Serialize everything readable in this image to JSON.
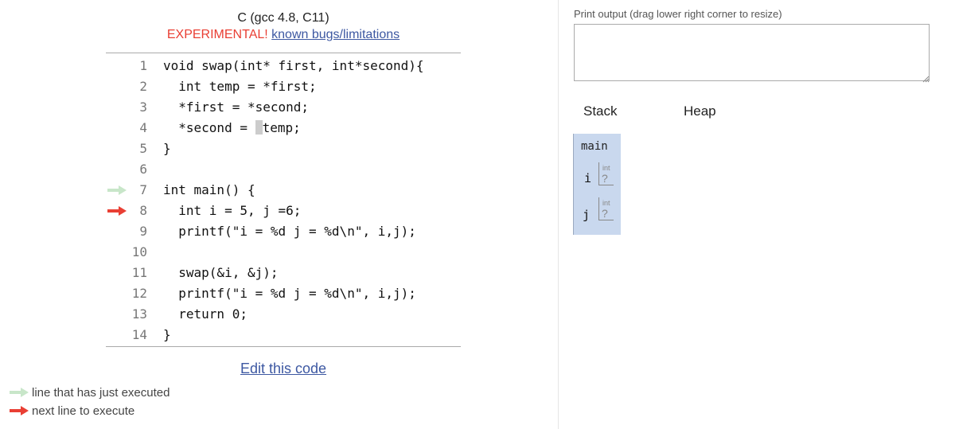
{
  "header": {
    "language": "C (gcc 4.8, C11)",
    "experimental": "EXPERIMENTAL!",
    "bugs_link": "known bugs/limitations"
  },
  "code": {
    "lines": [
      {
        "n": "1",
        "text": "void swap(int* first, int*second){"
      },
      {
        "n": "2",
        "text": "  int temp = *first;"
      },
      {
        "n": "3",
        "text": "  *first = *second;"
      },
      {
        "n": "4a",
        "text": "  *second = "
      },
      {
        "n": "4b",
        "text": "temp;"
      },
      {
        "n": "5",
        "text": "}"
      },
      {
        "n": "6",
        "text": ""
      },
      {
        "n": "7",
        "text": "int main() {"
      },
      {
        "n": "8",
        "text": "  int i = 5, j =6;"
      },
      {
        "n": "9",
        "text": "  printf(\"i = %d j = %d\\n\", i,j);"
      },
      {
        "n": "10",
        "text": ""
      },
      {
        "n": "11",
        "text": "  swap(&i, &j);"
      },
      {
        "n": "12",
        "text": "  printf(\"i = %d j = %d\\n\", i,j);"
      },
      {
        "n": "13",
        "text": "  return 0;"
      },
      {
        "n": "14",
        "text": "}"
      }
    ],
    "line_numbers": [
      "1",
      "2",
      "3",
      "4",
      "5",
      "6",
      "7",
      "8",
      "9",
      "10",
      "11",
      "12",
      "13",
      "14"
    ]
  },
  "edit_link": "Edit this code",
  "legend": {
    "executed": "line that has just executed",
    "next": "next line to execute"
  },
  "output": {
    "label": "Print output (drag lower right corner to resize)",
    "value": ""
  },
  "viz": {
    "stack_label": "Stack",
    "heap_label": "Heap",
    "frame_name": "main",
    "vars": [
      {
        "name": "i",
        "type": "int",
        "value": "?"
      },
      {
        "name": "j",
        "type": "int",
        "value": "?"
      }
    ]
  },
  "colors": {
    "executed_arrow": "#c8e6c9",
    "next_arrow": "#e93f34",
    "frame_bg": "#c9d8ee",
    "link": "#3d58a2"
  }
}
